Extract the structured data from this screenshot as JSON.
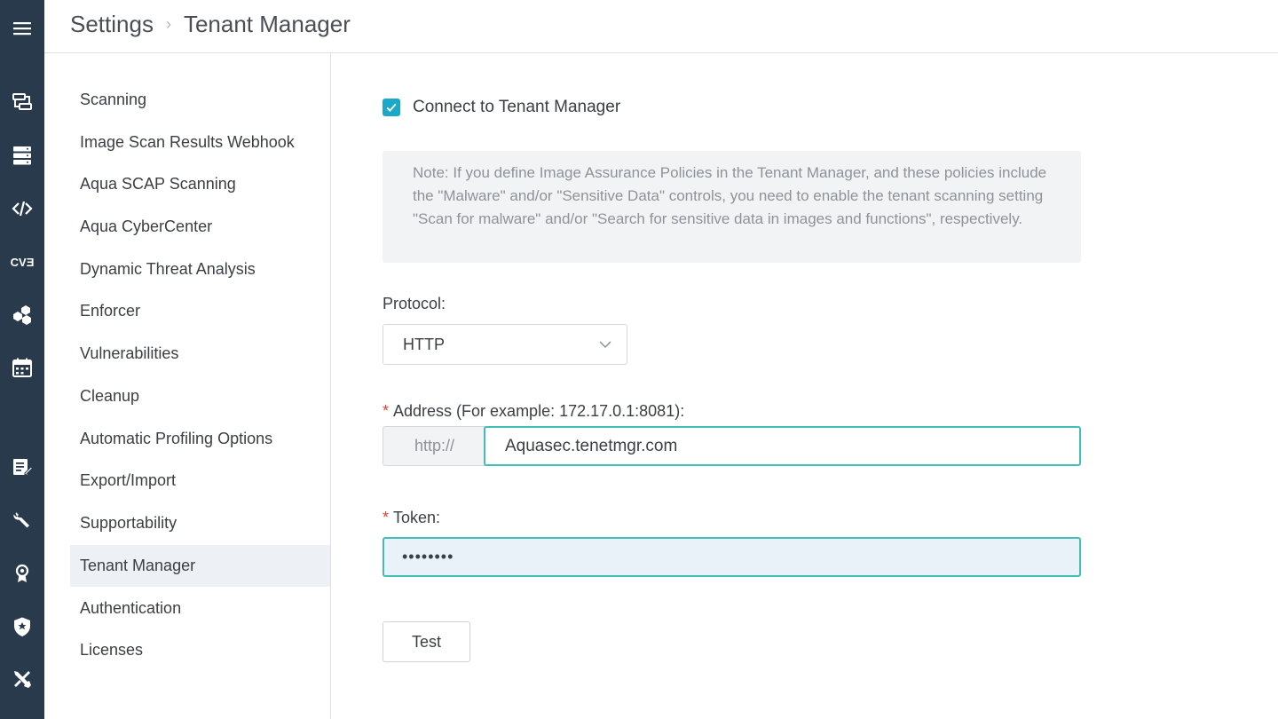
{
  "header": {
    "crumb_root": "Settings",
    "crumb_separator": "›",
    "crumb_current": "Tenant Manager"
  },
  "rail": {
    "icons": [
      "menu-icon",
      "network-icon",
      "servers-icon",
      "code-icon",
      "cve-icon",
      "nodes-icon",
      "calendar-icon",
      "report-icon",
      "wrench-icon",
      "badge-icon",
      "shield-icon",
      "tools-icon"
    ],
    "cve_text": "CVƎ"
  },
  "nav": {
    "items": [
      {
        "label": "Scanning"
      },
      {
        "label": "Image Scan Results Webhook"
      },
      {
        "label": "Aqua SCAP Scanning"
      },
      {
        "label": "Aqua CyberCenter"
      },
      {
        "label": "Dynamic Threat Analysis"
      },
      {
        "label": "Enforcer"
      },
      {
        "label": "Vulnerabilities"
      },
      {
        "label": "Cleanup"
      },
      {
        "label": "Automatic Profiling Options"
      },
      {
        "label": "Export/Import"
      },
      {
        "label": "Supportability"
      },
      {
        "label": "Tenant Manager"
      },
      {
        "label": "Authentication"
      },
      {
        "label": "Licenses"
      }
    ],
    "active": "Tenant Manager"
  },
  "form": {
    "connect_label": "Connect to Tenant Manager",
    "connect_checked": true,
    "note": "Note: If you define Image Assurance Policies in the Tenant Manager, and these policies include the \"Malware\" and/or \"Sensitive Data\" controls, you need to enable the tenant scanning setting \"Scan for malware\" and/or \"Search for sensitive data in images and functions\", respectively.",
    "protocol_label": "Protocol:",
    "protocol_value": "HTTP",
    "required_mark": "*",
    "address_label": "Address (For example: 172.17.0.1:8081):",
    "address_prefix": "http://",
    "address_value": "Aquasec.tenetmgr.com",
    "token_label": "Token:",
    "token_value": "••••••••",
    "test_label": "Test"
  },
  "colors": {
    "rail_bg": "#2a3a4d",
    "accent_checkbox": "#1ba8c9",
    "focus_border": "#3fbfb5",
    "required": "#e0432f",
    "active_nav_bg": "#edf1f6"
  }
}
